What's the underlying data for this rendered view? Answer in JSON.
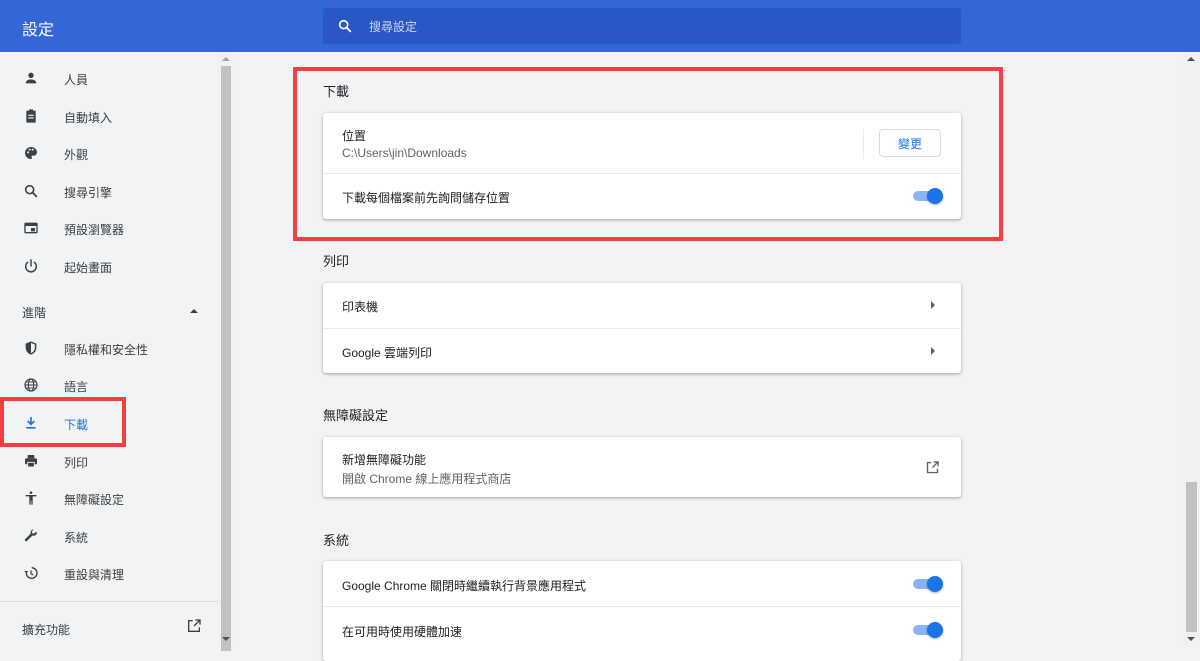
{
  "header": {
    "title": "設定",
    "search_placeholder": "搜尋設定"
  },
  "sidebar": {
    "items": [
      {
        "label": "人員",
        "icon": "person-icon"
      },
      {
        "label": "自動填入",
        "icon": "clipboard-icon"
      },
      {
        "label": "外觀",
        "icon": "palette-icon"
      },
      {
        "label": "搜尋引擎",
        "icon": "search-icon"
      },
      {
        "label": "預設瀏覽器",
        "icon": "browser-icon"
      },
      {
        "label": "起始畫面",
        "icon": "power-icon"
      }
    ],
    "advanced_label": "進階",
    "advanced_items": [
      {
        "label": "隱私權和安全性",
        "icon": "shield-icon"
      },
      {
        "label": "語言",
        "icon": "globe-icon"
      },
      {
        "label": "下載",
        "icon": "download-icon",
        "active": true
      },
      {
        "label": "列印",
        "icon": "printer-icon"
      },
      {
        "label": "無障礙設定",
        "icon": "accessibility-icon"
      },
      {
        "label": "系統",
        "icon": "wrench-icon"
      },
      {
        "label": "重設與清理",
        "icon": "history-icon"
      }
    ],
    "extensions_label": "擴充功能"
  },
  "main": {
    "downloads": {
      "title": "下載",
      "location_label": "位置",
      "location_value": "C:\\Users\\jin\\Downloads",
      "change_button": "變更",
      "ask_label": "下載每個檔案前先詢問儲存位置",
      "ask_enabled": true
    },
    "printing": {
      "title": "列印",
      "printers_label": "印表機",
      "cloud_print_label": "Google 雲端列印"
    },
    "accessibility": {
      "title": "無障礙設定",
      "add_features_label": "新增無障礙功能",
      "add_features_sub": "開啟 Chrome 線上應用程式商店"
    },
    "system": {
      "title": "系統",
      "background_apps_label": "Google Chrome 關閉時繼續執行背景應用程式",
      "background_apps_enabled": true,
      "hardware_accel_label": "在可用時使用硬體加速",
      "hardware_accel_enabled": true
    }
  },
  "colors": {
    "header_bg": "#3367d6",
    "accent": "#1a73e8",
    "highlight": "#f04040"
  }
}
